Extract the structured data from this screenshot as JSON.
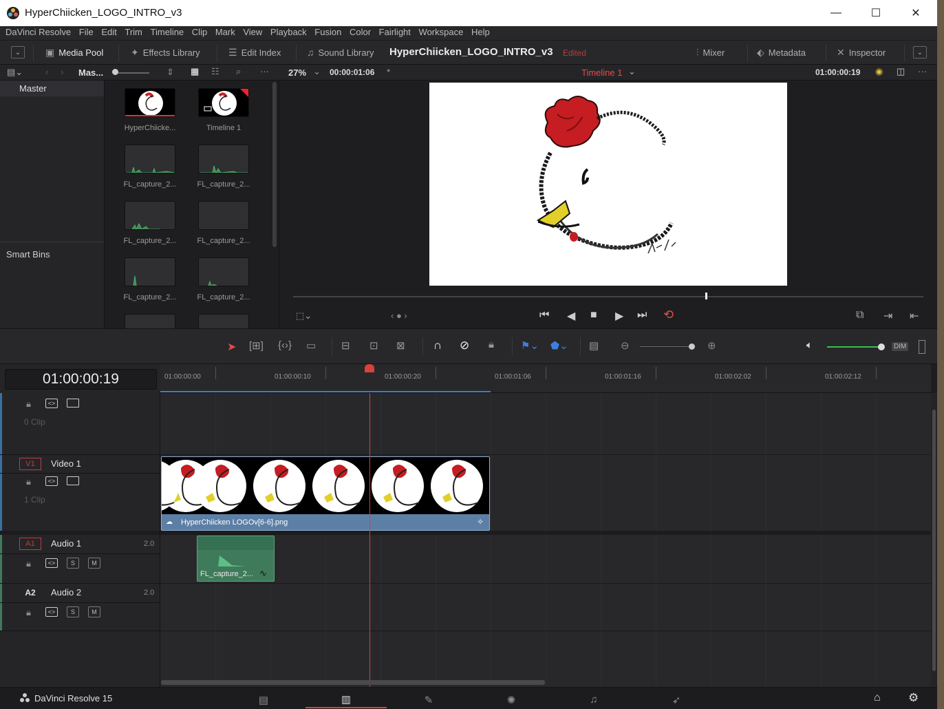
{
  "window": {
    "title": "HyperChiicken_LOGO_INTRO_v3",
    "minimize": "—",
    "maximize": "☐",
    "close": "✕"
  },
  "menu": [
    "DaVinci Resolve",
    "File",
    "Edit",
    "Trim",
    "Timeline",
    "Clip",
    "Mark",
    "View",
    "Playback",
    "Fusion",
    "Color",
    "Fairlight",
    "Workspace",
    "Help"
  ],
  "toolbar": {
    "media_pool": "Media Pool",
    "effects_library": "Effects Library",
    "edit_index": "Edit Index",
    "sound_library": "Sound Library",
    "project_title": "HyperChiicken_LOGO_INTRO_v3",
    "edited": "Edited",
    "mixer": "Mixer",
    "metadata": "Metadata",
    "inspector": "Inspector"
  },
  "subbar": {
    "bin_name": "Mas...",
    "zoom": "27%",
    "source_timecode": "00:00:01:06",
    "timeline_name": "Timeline 1",
    "record_timecode": "01:00:00:19"
  },
  "bins": {
    "master": "Master",
    "smart_bins": "Smart Bins"
  },
  "media_pool": [
    {
      "label": "HyperChiicke...",
      "kind": "image"
    },
    {
      "label": "Timeline 1",
      "kind": "timeline"
    },
    {
      "label": "FL_capture_2...",
      "kind": "audio"
    },
    {
      "label": "FL_capture_2...",
      "kind": "audio"
    },
    {
      "label": "FL_capture_2...",
      "kind": "audio"
    },
    {
      "label": "FL_capture_2...",
      "kind": "audio"
    },
    {
      "label": "FL_capture_2...",
      "kind": "audio"
    },
    {
      "label": "FL_capture_2...",
      "kind": "audio"
    }
  ],
  "timeline": {
    "current_timecode": "01:00:00:19",
    "ruler_ticks": [
      "01:00:00:00",
      "01:00:00:10",
      "01:00:00:20",
      "01:00:01:06",
      "01:00:01:16",
      "01:00:02:02",
      "01:00:02:12"
    ],
    "tracks": {
      "v2": {
        "clip_count": "0 Clip"
      },
      "v1": {
        "tag": "V1",
        "name": "Video 1",
        "clip_count": "1 Clip"
      },
      "a1": {
        "tag": "A1",
        "name": "Audio 1",
        "channels": "2.0",
        "solo": "S",
        "mute": "M"
      },
      "a2": {
        "tag": "A2",
        "name": "Audio 2",
        "channels": "2.0",
        "solo": "S",
        "mute": "M"
      }
    },
    "video_clip_name": "HyperChiicken LOGOv[6-6].png",
    "audio_clip_name": "FL_capture_2..."
  },
  "status": {
    "app_name": "DaVinci Resolve 15"
  },
  "audio_dim": "DIM",
  "colors": {
    "accent_red": "#e64b4b",
    "clip_blue": "#5c7fa6",
    "audio_green": "#3f7a5a",
    "playhead": "#d9413b"
  }
}
